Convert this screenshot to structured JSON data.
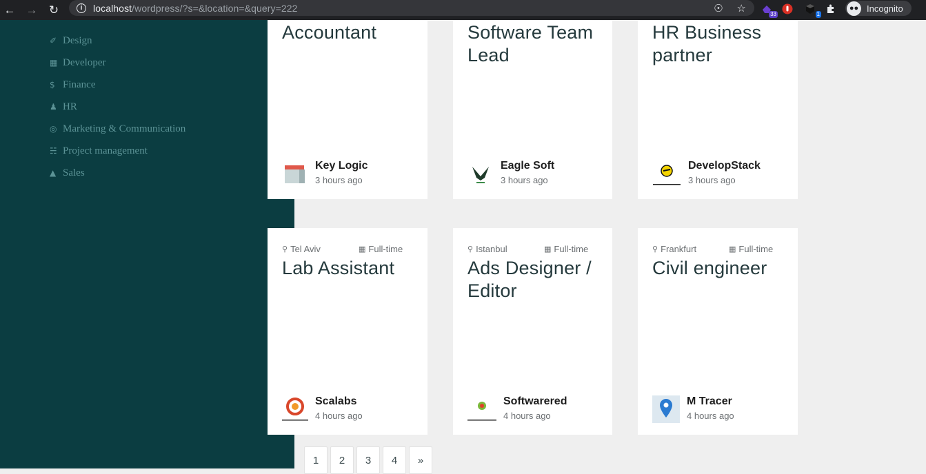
{
  "browser": {
    "url_host": "localhost",
    "url_path": "/wordpress/?s=&location=&query=222",
    "incognito_label": "Incognito",
    "ext_badge_1": "33",
    "ext_badge_2": "1"
  },
  "sidebar": {
    "items": [
      {
        "label": "Design",
        "icon": "pencil-ruler-icon"
      },
      {
        "label": "Developer",
        "icon": "code-icon"
      },
      {
        "label": "Finance",
        "icon": "dollar-icon"
      },
      {
        "label": "HR",
        "icon": "people-icon"
      },
      {
        "label": "Marketing & Communication",
        "icon": "target-icon"
      },
      {
        "label": "Project management",
        "icon": "sitemap-icon"
      },
      {
        "label": "Sales",
        "icon": "basket-icon"
      }
    ]
  },
  "jobs_top": [
    {
      "title": "Accountant",
      "company": "Key Logic",
      "time": "3 hours ago"
    },
    {
      "title": "Software Team Lead",
      "company": "Eagle Soft",
      "time": "3 hours ago"
    },
    {
      "title": "HR Business partner",
      "company": "DevelopStack",
      "time": "3 hours ago"
    }
  ],
  "jobs_bottom": [
    {
      "location": "Tel Aviv",
      "type": "Full-time",
      "title": "Lab Assistant",
      "company": "Scalabs",
      "time": "4 hours ago"
    },
    {
      "location": "Istanbul",
      "type": "Full-time",
      "title": "Ads Designer / Editor",
      "company": "Softwarered",
      "time": "4 hours ago"
    },
    {
      "location": "Frankfurt",
      "type": "Full-time",
      "title": "Civil engineer",
      "company": "M Tracer",
      "time": "4 hours ago"
    }
  ],
  "pagination": [
    "1",
    "2",
    "3",
    "4",
    "»"
  ],
  "colors": {
    "sidebar": "#0b3d41",
    "background": "#efefef",
    "title": "#253a3d"
  }
}
